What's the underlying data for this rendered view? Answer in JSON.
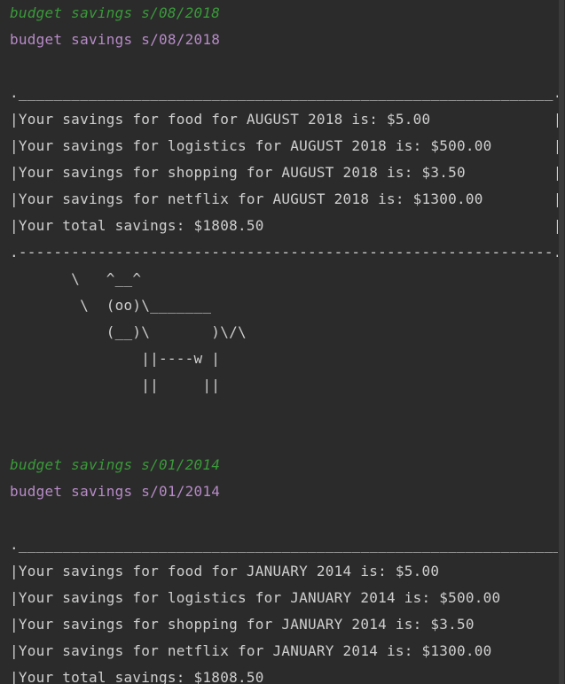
{
  "terminal": {
    "blocks": [
      {
        "command": "budget savings s/08/2018",
        "echo": "budget savings s/08/2018",
        "top_border": "._____________________________________________________________.",
        "rows": [
          "|Your savings for food for AUGUST 2018 is: $5.00              |",
          "|Your savings for logistics for AUGUST 2018 is: $500.00       |",
          "|Your savings for shopping for AUGUST 2018 is: $3.50          |",
          "|Your savings for netflix for AUGUST 2018 is: $1300.00        |",
          "|Your total savings: $1808.50                                 |"
        ],
        "bottom_border": ".-------------------------------------------------------------.",
        "cow": [
          "       \\   ^__^",
          "        \\  (oo)\\_______",
          "           (__)\\       )\\/\\",
          "               ||----w |",
          "               ||     ||"
        ]
      },
      {
        "command": "budget savings s/01/2014",
        "echo": "budget savings s/01/2014",
        "top_border": ".______________________________________________________________.",
        "rows": [
          "|Your savings for food for JANUARY 2014 is: $5.00              |",
          "|Your savings for logistics for JANUARY 2014 is: $500.00       |",
          "|Your savings for shopping for JANUARY 2014 is: $3.50          |",
          "|Your savings for netflix for JANUARY 2014 is: $1300.00        |",
          "|Your total savings: $1808.50"
        ]
      }
    ]
  },
  "colors": {
    "background": "#2b2b2b",
    "command": "#3a9a3a",
    "echo": "#b78bc7",
    "text": "#cfcfcf"
  }
}
